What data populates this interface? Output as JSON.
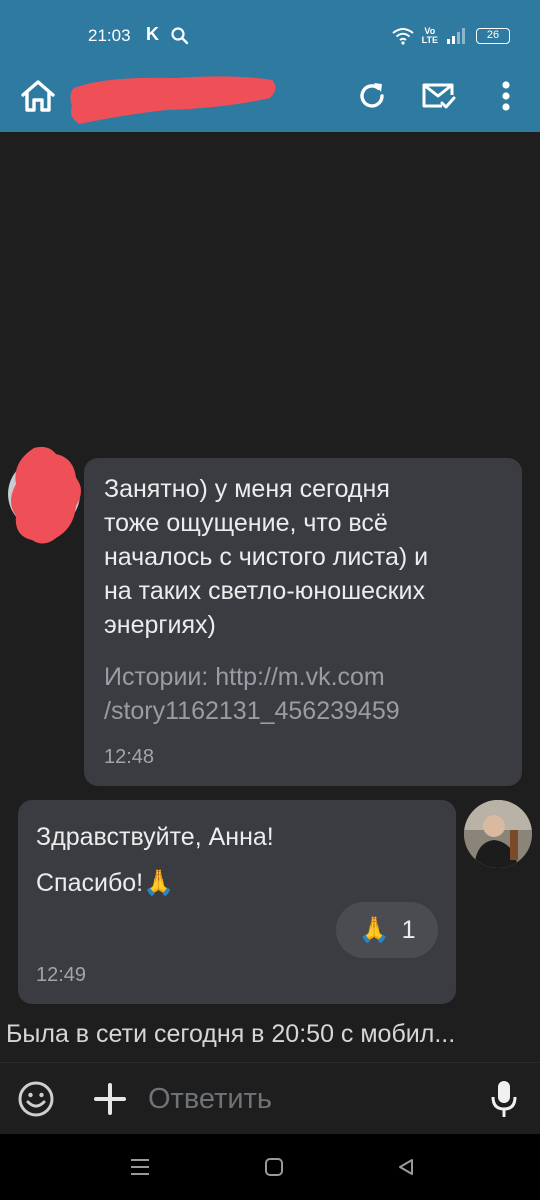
{
  "status_bar": {
    "time": "21:03",
    "carrier_icon_label": "K",
    "network_label": "Vo\nLTE",
    "battery": "26",
    "icons": [
      "search-icon",
      "wifi-icon",
      "signal-icon",
      "battery-icon"
    ]
  },
  "header": {
    "icons": [
      "home-icon",
      "refresh-icon",
      "mark-read-mail-icon",
      "more-vertical-icon"
    ],
    "colors": {
      "background": "#2e7aa0",
      "redaction": "#ef5058"
    }
  },
  "messages": [
    {
      "direction": "incoming",
      "text_lines": [
        "Занятно) у меня сегодня",
        "тоже ощущение, что всё",
        "началось с чистого листа) и",
        "на таких светло-юношеских",
        "энергиях)"
      ],
      "link_lines": [
        "Истории: http://m.vk.com",
        "/story1162131_456239459"
      ],
      "time": "12:48"
    },
    {
      "direction": "outgoing",
      "text_lines": [
        "Здравствуйте, Анна!",
        "Спасибо!"
      ],
      "emoji": "🙏",
      "reaction": {
        "emoji": "🙏",
        "count": "1"
      },
      "time": "12:49"
    }
  ],
  "presence": "Была в сети сегодня в 20:50 с мобил...",
  "composer": {
    "placeholder": "Ответить",
    "icons": [
      "emoji-icon",
      "plus-icon",
      "microphone-icon"
    ]
  },
  "system_nav": {
    "icons": [
      "recent-apps-icon",
      "home-square-icon",
      "back-triangle-icon"
    ]
  },
  "colors": {
    "bubble": "#3a3c42",
    "chat_background": "#1e1e1e",
    "reaction_pill": "#4a4c52"
  }
}
